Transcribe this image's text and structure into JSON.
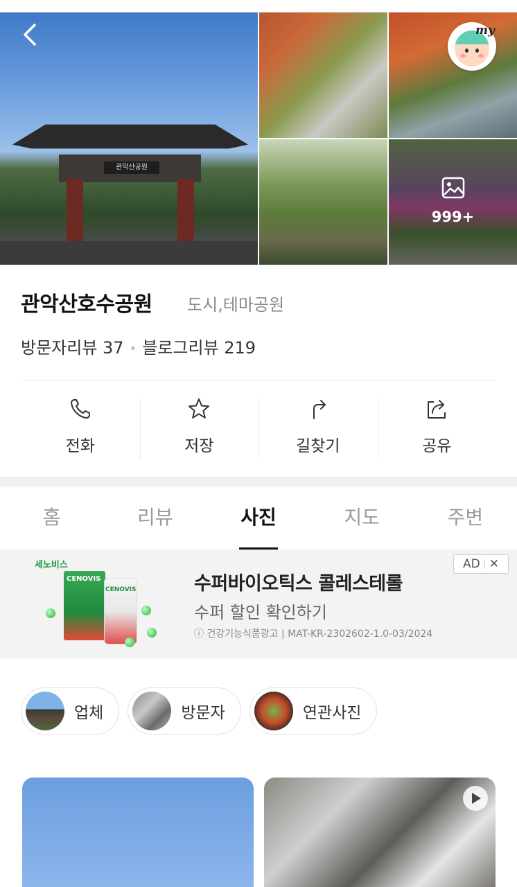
{
  "gallery": {
    "more_count": "999+",
    "gate_sign": "관악산공원"
  },
  "place": {
    "name": "관악산호수공원",
    "category": "도시,테마공원",
    "visitor_reviews": "방문자리뷰 37",
    "blog_reviews": "블로그리뷰 219"
  },
  "actions": [
    {
      "label": "전화",
      "icon": "phone-icon"
    },
    {
      "label": "저장",
      "icon": "star-icon"
    },
    {
      "label": "길찾기",
      "icon": "directions-icon"
    },
    {
      "label": "공유",
      "icon": "share-icon"
    }
  ],
  "tabs": [
    {
      "label": "홈",
      "active": false
    },
    {
      "label": "리뷰",
      "active": false
    },
    {
      "label": "사진",
      "active": true
    },
    {
      "label": "지도",
      "active": false
    },
    {
      "label": "주변",
      "active": false
    }
  ],
  "ad": {
    "brand": "세노비스",
    "box_label": "CENOVIS",
    "title": "수퍼바이오틱스 콜레스테롤",
    "subtitle": "수퍼 할인 확인하기",
    "note": "ⓘ 건강기능식품광고 | MAT-KR-2302602-1.0-03/2024",
    "tag": "AD",
    "close": "✕"
  },
  "chips": [
    {
      "label": "업체"
    },
    {
      "label": "방문자"
    },
    {
      "label": "연관사진"
    }
  ],
  "profile": {
    "badge": "my"
  },
  "colors": {
    "accent_green": "#1c9a3c",
    "active_tab": "#111111",
    "muted_text": "#9a9a9a"
  }
}
